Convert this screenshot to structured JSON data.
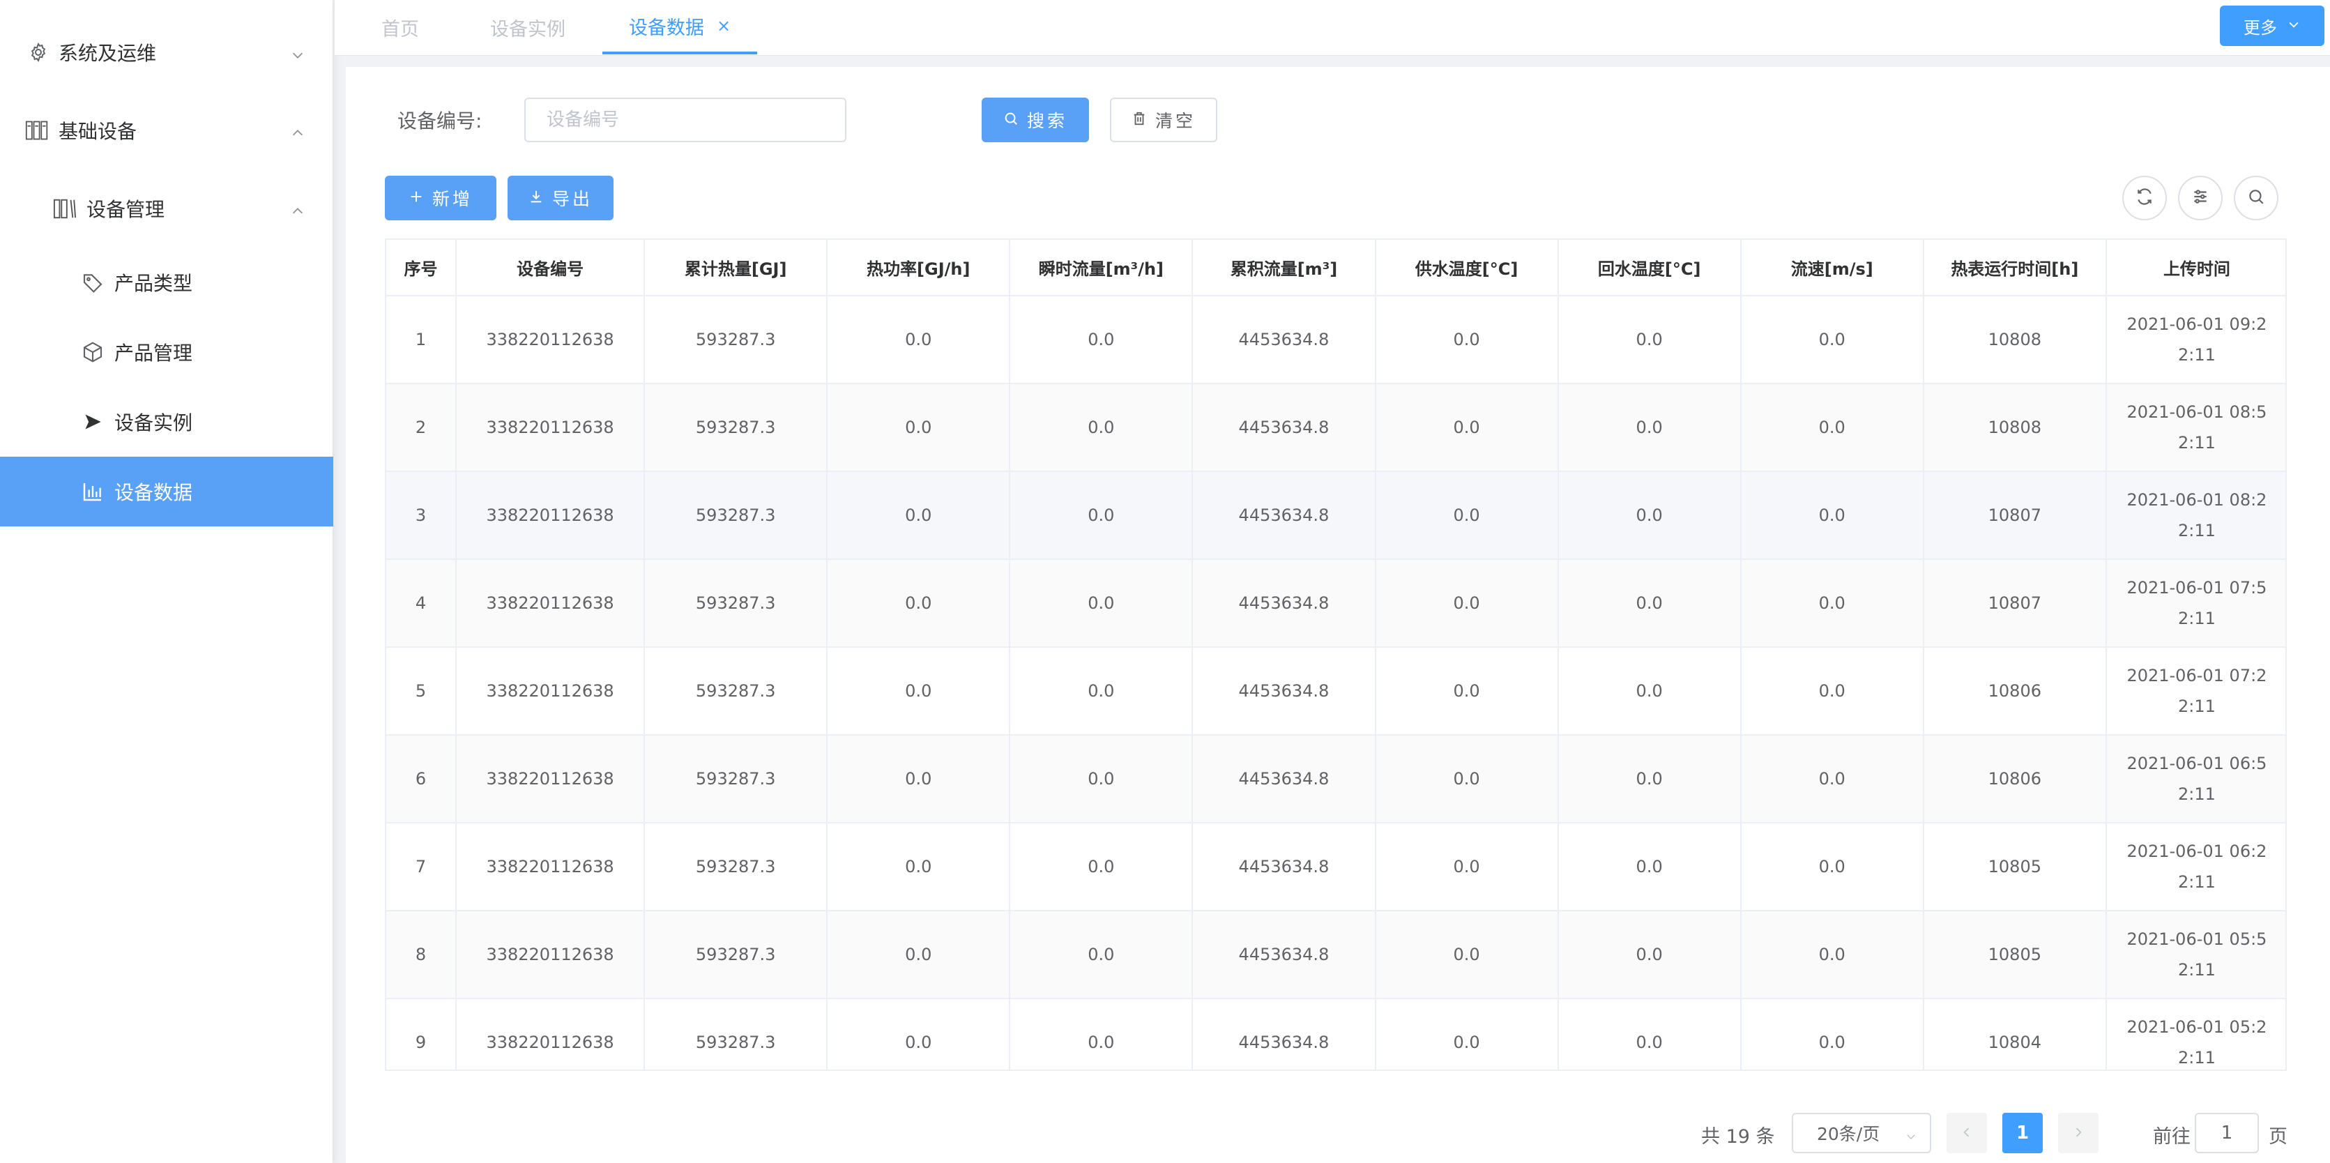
{
  "sidebar": {
    "items": [
      {
        "label": "系统及运维",
        "icon": "gear-icon",
        "arrow": "chevron-down-icon"
      },
      {
        "label": "基础设备",
        "icon": "rack-icon",
        "arrow": "chevron-up-icon"
      },
      {
        "label": "设备管理",
        "icon": "books-icon",
        "arrow": "chevron-up-icon"
      },
      {
        "label": "产品类型",
        "icon": "tag-icon"
      },
      {
        "label": "产品管理",
        "icon": "box-icon"
      },
      {
        "label": "设备实例",
        "icon": "send-icon"
      },
      {
        "label": "设备数据",
        "icon": "bar-chart-icon",
        "active": true
      }
    ]
  },
  "tabs": {
    "items": [
      {
        "label": "首页"
      },
      {
        "label": "设备实例"
      },
      {
        "label": "设备数据",
        "active": true,
        "close": "×"
      }
    ],
    "more_label": "更多"
  },
  "search": {
    "label": "设备编号:",
    "input_value": "",
    "input_placeholder": "设备编号",
    "search_button": "搜索",
    "clear_button": "清空"
  },
  "toolbar": {
    "add_button": "新增",
    "export_button": "导出"
  },
  "table": {
    "columns": [
      "序号",
      "设备编号",
      "累计热量[GJ]",
      "热功率[GJ/h]",
      "瞬时流量[m³/h]",
      "累积流量[m³]",
      "供水温度[°C]",
      "回水温度[°C]",
      "流速[m/s]",
      "热表运行时间[h]",
      "上传时间"
    ],
    "rows": [
      [
        "1",
        "338220112638",
        "593287.3",
        "0.0",
        "0.0",
        "4453634.8",
        "0.0",
        "0.0",
        "0.0",
        "10808",
        "2021-06-01 09:22:11"
      ],
      [
        "2",
        "338220112638",
        "593287.3",
        "0.0",
        "0.0",
        "4453634.8",
        "0.0",
        "0.0",
        "0.0",
        "10808",
        "2021-06-01 08:52:11"
      ],
      [
        "3",
        "338220112638",
        "593287.3",
        "0.0",
        "0.0",
        "4453634.8",
        "0.0",
        "0.0",
        "0.0",
        "10807",
        "2021-06-01 08:22:11"
      ],
      [
        "4",
        "338220112638",
        "593287.3",
        "0.0",
        "0.0",
        "4453634.8",
        "0.0",
        "0.0",
        "0.0",
        "10807",
        "2021-06-01 07:52:11"
      ],
      [
        "5",
        "338220112638",
        "593287.3",
        "0.0",
        "0.0",
        "4453634.8",
        "0.0",
        "0.0",
        "0.0",
        "10806",
        "2021-06-01 07:22:11"
      ],
      [
        "6",
        "338220112638",
        "593287.3",
        "0.0",
        "0.0",
        "4453634.8",
        "0.0",
        "0.0",
        "0.0",
        "10806",
        "2021-06-01 06:52:11"
      ],
      [
        "7",
        "338220112638",
        "593287.3",
        "0.0",
        "0.0",
        "4453634.8",
        "0.0",
        "0.0",
        "0.0",
        "10805",
        "2021-06-01 06:22:11"
      ],
      [
        "8",
        "338220112638",
        "593287.3",
        "0.0",
        "0.0",
        "4453634.8",
        "0.0",
        "0.0",
        "0.0",
        "10805",
        "2021-06-01 05:52:11"
      ],
      [
        "9",
        "338220112638",
        "593287.3",
        "0.0",
        "0.0",
        "4453634.8",
        "0.0",
        "0.0",
        "0.0",
        "10804",
        "2021-06-01 05:22:11"
      ]
    ]
  },
  "pagination": {
    "total": "共 19 条",
    "page_size": "20条/页",
    "current_page": "1",
    "goto_label": "前往",
    "goto_value": "1",
    "page_suffix": "页"
  },
  "colors": {
    "primary": "#409eff",
    "menu_active": "#59a1f6",
    "border": "#ebeef5"
  }
}
